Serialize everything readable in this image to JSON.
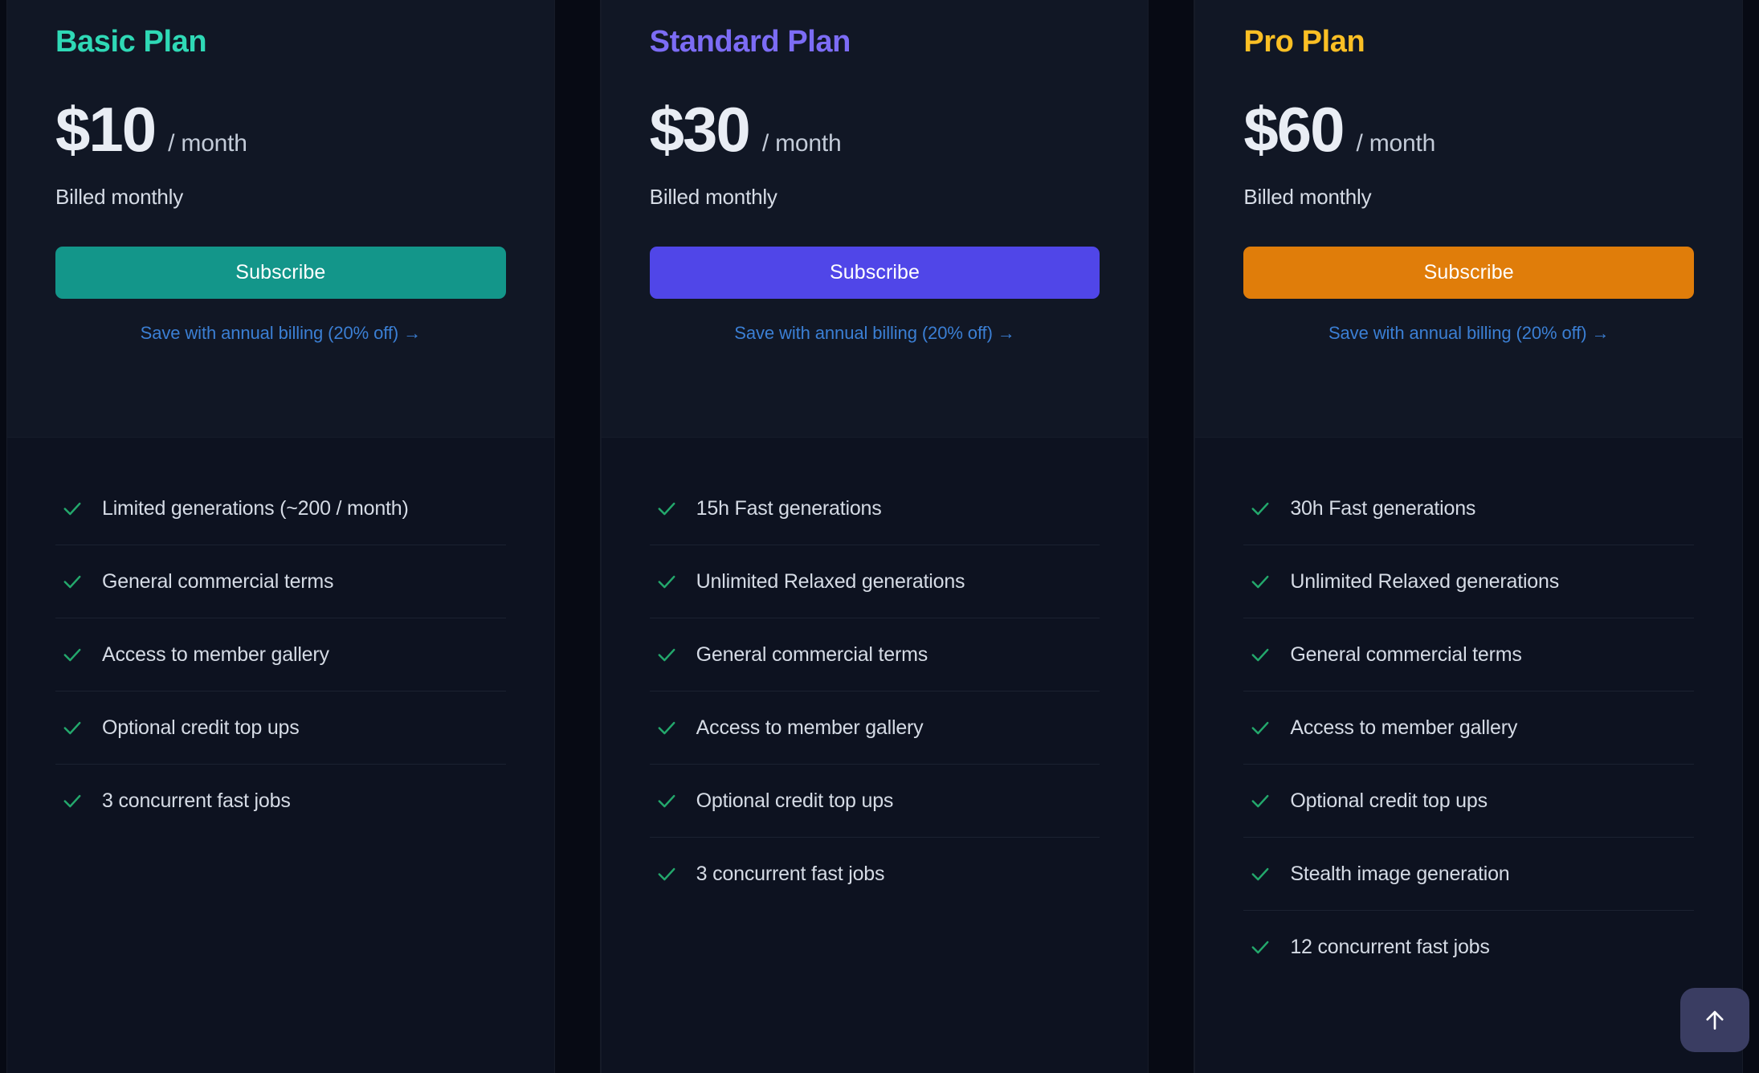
{
  "theme": {
    "page_background": "#05080f",
    "card_background": "#0d1220",
    "card_header_background": "#111725",
    "divider_color": "#1b2231",
    "link_color": "#3b7fd4",
    "check_color": "#23a86c",
    "price_text_color": "#e9edf4"
  },
  "plans": [
    {
      "id": "basic",
      "title": "Basic Plan",
      "title_color": "#2fd9b6",
      "price": "$10",
      "period": "/ month",
      "billing_note": "Billed monthly",
      "subscribe_label": "Subscribe",
      "subscribe_color": "#13968a",
      "annual_link_label": "Save with annual billing (20% off)",
      "annual_link_arrow": "→",
      "features": [
        "Limited generations (~200 / month)",
        "General commercial terms",
        "Access to member gallery",
        "Optional credit top ups",
        "3 concurrent fast jobs"
      ]
    },
    {
      "id": "standard",
      "title": "Standard Plan",
      "title_color": "#7c6cf5",
      "price": "$30",
      "period": "/ month",
      "billing_note": "Billed monthly",
      "subscribe_label": "Subscribe",
      "subscribe_color": "#5046e8",
      "annual_link_label": "Save with annual billing (20% off)",
      "annual_link_arrow": "→",
      "features": [
        "15h Fast generations",
        "Unlimited Relaxed generations",
        "General commercial terms",
        "Access to member gallery",
        "Optional credit top ups",
        "3 concurrent fast jobs"
      ]
    },
    {
      "id": "pro",
      "title": "Pro Plan",
      "title_color": "#fbbf24",
      "price": "$60",
      "period": "/ month",
      "billing_note": "Billed monthly",
      "subscribe_label": "Subscribe",
      "subscribe_color": "#e07d0a",
      "annual_link_label": "Save with annual billing (20% off)",
      "annual_link_arrow": "→",
      "features": [
        "30h Fast generations",
        "Unlimited Relaxed generations",
        "General commercial terms",
        "Access to member gallery",
        "Optional credit top ups",
        "Stealth image generation",
        "12 concurrent fast jobs"
      ]
    }
  ],
  "scroll_to_top": {
    "icon": "arrow-up-icon",
    "background": "#3a3d62"
  }
}
